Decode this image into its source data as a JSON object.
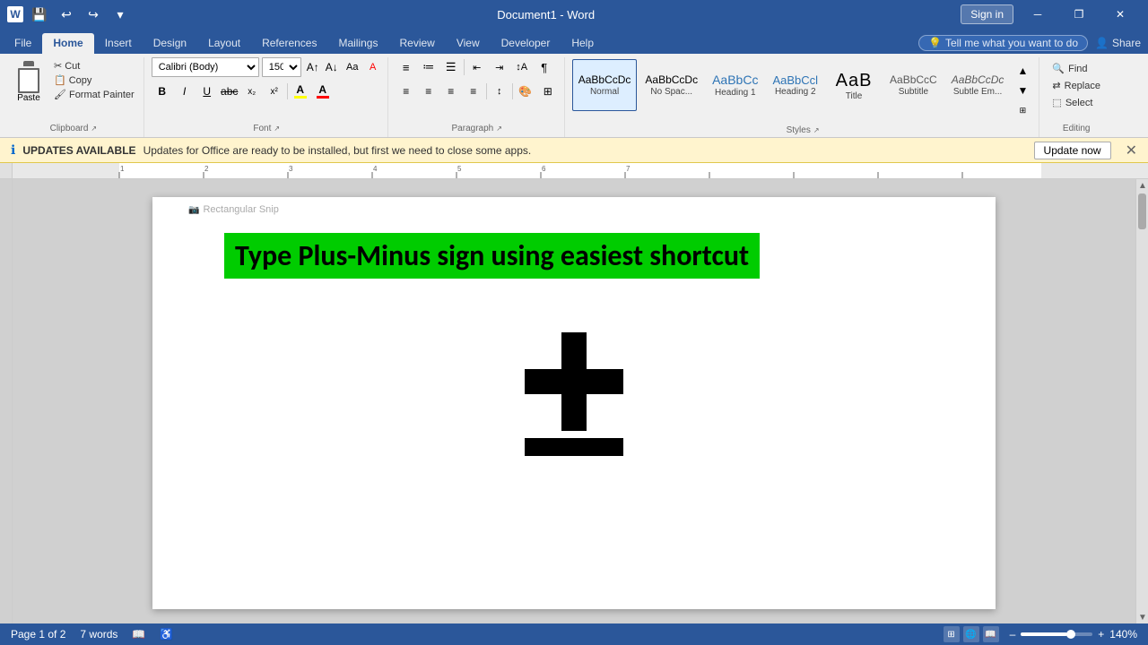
{
  "titlebar": {
    "doc_name": "Document1  -  Word",
    "sign_in": "Sign in",
    "undo_symbol": "↩",
    "redo_symbol": "↪",
    "save_symbol": "💾",
    "minimize": "─",
    "restore": "❐",
    "close": "✕"
  },
  "tabs": [
    "File",
    "Home",
    "Insert",
    "Design",
    "Layout",
    "References",
    "Mailings",
    "Review",
    "View",
    "Developer",
    "Help"
  ],
  "active_tab": "Home",
  "tell_me": "Tell me what you want to do",
  "share": "Share",
  "ribbon": {
    "clipboard": {
      "label": "Clipboard",
      "paste": "Paste",
      "cut": "Cut",
      "copy": "Copy",
      "format_painter": "Format Painter"
    },
    "font": {
      "label": "Font",
      "font_name": "Calibri (Body)",
      "font_size": "150",
      "bold": "B",
      "italic": "I",
      "underline": "U",
      "strikethrough": "abc",
      "superscript": "x²",
      "subscript": "x₂",
      "clear_formatting": "A",
      "text_highlight": "A",
      "font_color": "A"
    },
    "paragraph": {
      "label": "Paragraph"
    },
    "styles": {
      "label": "Styles",
      "items": [
        {
          "name": "Normal",
          "preview": "AaBbCcDc",
          "active": true
        },
        {
          "name": "No Spac...",
          "preview": "AaBbCcDc"
        },
        {
          "name": "Heading 1",
          "preview": "AaBbCc"
        },
        {
          "name": "Heading 2",
          "preview": "AaBbCcl"
        },
        {
          "name": "Title",
          "preview": "AaB"
        },
        {
          "name": "Subtitle",
          "preview": "AaBbCcC"
        },
        {
          "name": "Subtle Em...",
          "preview": "AaBbCcDc"
        }
      ]
    },
    "editing": {
      "label": "Editing",
      "find": "Find",
      "replace": "Replace",
      "select": "Select"
    }
  },
  "banner": {
    "icon": "ℹ",
    "label": "UPDATES AVAILABLE",
    "message": "Updates for Office are ready to be installed, but first we need to close some apps.",
    "button": "Update now",
    "close": "✕"
  },
  "document": {
    "title": "Type Plus-Minus sign using easiest shortcut",
    "snip_label": "Rectangular Snip",
    "plus_minus_symbol": "±"
  },
  "statusbar": {
    "page": "Page 1 of 2",
    "words": "7 words",
    "zoom": "140%"
  }
}
